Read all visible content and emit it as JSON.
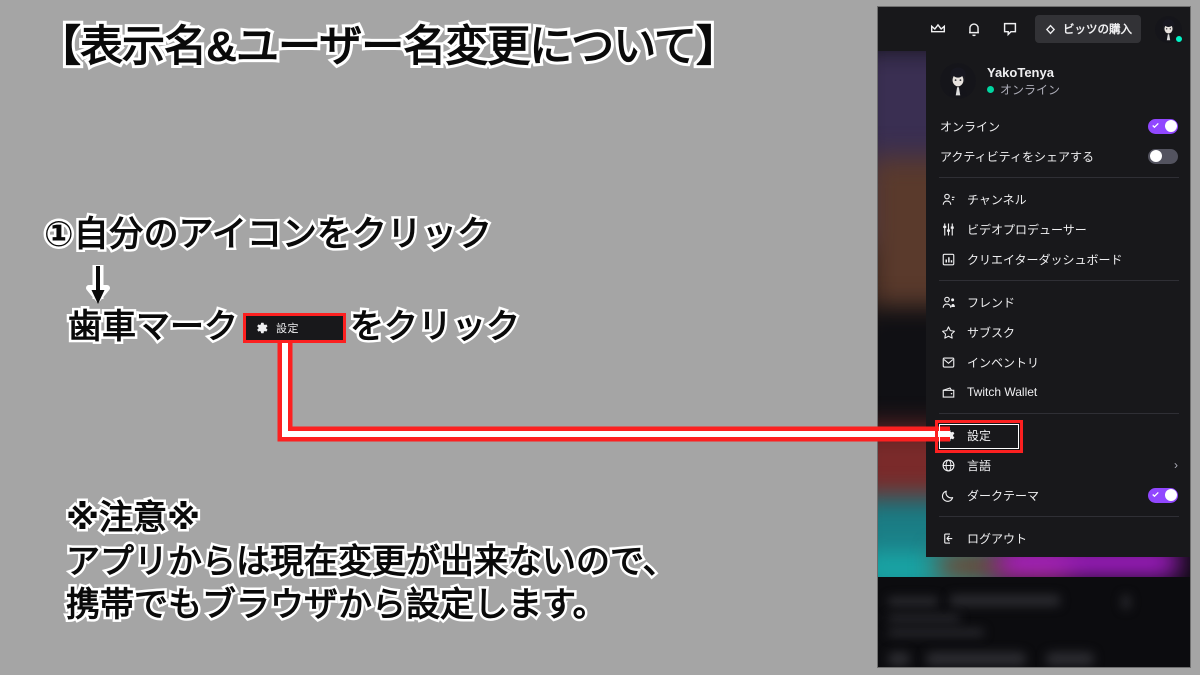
{
  "annotations": {
    "title": "【表示名&ユーザー名変更について】",
    "step1": "①自分のアイコンをクリック",
    "step2_before": "歯車マーク",
    "step2_after": "をクリック",
    "inset_label": "設定",
    "note_line1": "※注意※",
    "note_line2": "アプリからは現在変更が出来ないので、",
    "note_line3": "携帯でもブラウザから設定します。"
  },
  "twitch": {
    "topbar": {
      "crown_icon": "crown-icon",
      "bell_icon": "bell-icon",
      "chat_icon": "chat-bubble-icon",
      "bits_label": "ビッツの購入",
      "bits_icon": "bits-diamond-icon",
      "avatar_icon": "user-avatar"
    },
    "account": {
      "username": "YakoTenya",
      "status": "オンライン"
    },
    "toggles": [
      {
        "label": "オンライン",
        "state": "on"
      },
      {
        "label": "アクティビティをシェアする",
        "state": "off"
      }
    ],
    "group1": [
      {
        "label": "チャンネル",
        "icon": "channel-person-icon"
      },
      {
        "label": "ビデオプロデューサー",
        "icon": "sliders-icon"
      },
      {
        "label": "クリエイターダッシュボード",
        "icon": "dashboard-chart-icon"
      }
    ],
    "group2": [
      {
        "label": "フレンド",
        "icon": "friends-icon"
      },
      {
        "label": "サブスク",
        "icon": "star-icon"
      },
      {
        "label": "インベントリ",
        "icon": "inventory-box-icon"
      },
      {
        "label": "Twitch Wallet",
        "icon": "wallet-icon"
      }
    ],
    "group3": [
      {
        "label": "設定",
        "icon": "gear-icon",
        "highlighted": true
      },
      {
        "label": "言語",
        "icon": "globe-icon",
        "chevron": "›"
      },
      {
        "label": "ダークテーマ",
        "icon": "moon-icon",
        "state": "on"
      }
    ],
    "group4": [
      {
        "label": "ログアウト",
        "icon": "logout-icon"
      }
    ]
  },
  "colors": {
    "page_background": "#a5a5a5",
    "twitch_purple": "#9147ff",
    "menu_background": "#18181b",
    "highlight_red": "#fc2020",
    "online_green": "#00d6a1",
    "text_primary": "#efeff1",
    "text_secondary": "#adadb8"
  }
}
